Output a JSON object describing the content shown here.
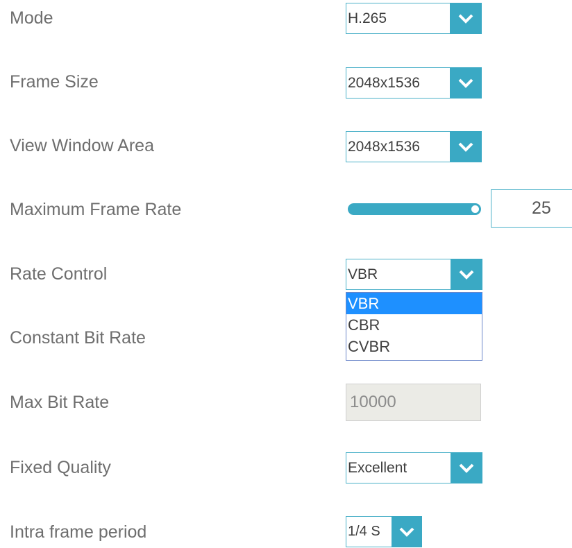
{
  "fields": {
    "mode": {
      "label": "Mode",
      "value": "H.265"
    },
    "frame_size": {
      "label": "Frame Size",
      "value": "2048x1536"
    },
    "view_window_area": {
      "label": "View Window Area",
      "value": "2048x1536"
    },
    "max_frame_rate": {
      "label": "Maximum Frame Rate",
      "value": "25",
      "slider_level_percent": 100
    },
    "rate_control": {
      "label": "Rate Control",
      "value": "VBR",
      "options": [
        "VBR",
        "CBR",
        "CVBR"
      ],
      "selected_option": "VBR"
    },
    "constant_bit_rate": {
      "label": "Constant Bit Rate"
    },
    "max_bit_rate": {
      "label": "Max Bit Rate",
      "value": "10000"
    },
    "fixed_quality": {
      "label": "Fixed Quality",
      "value": "Excellent"
    },
    "intra_frame_period": {
      "label": "Intra frame period",
      "value": "1/4 S"
    }
  },
  "icons": {
    "dropdown_button": "chevron-down-icon"
  },
  "colors": {
    "accent": "#3aa9c4",
    "selected_option": "#1e90ff",
    "label_text": "#6e6e6e",
    "disabled_bg": "#ebebe6"
  }
}
